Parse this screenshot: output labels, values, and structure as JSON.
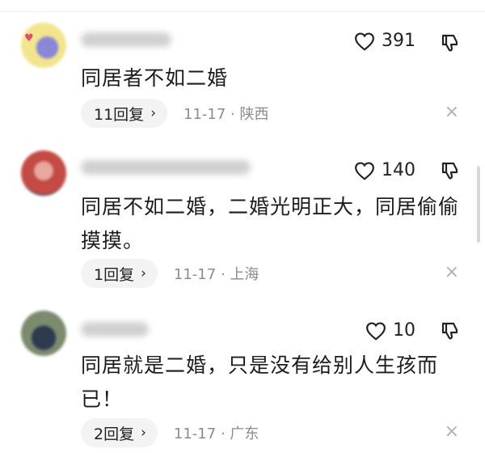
{
  "comments": [
    {
      "likes": "391",
      "text": "同居者不如二婚",
      "reply_label": "11回复",
      "date": "11-17",
      "location": "陕西"
    },
    {
      "likes": "140",
      "text": "同居不如二婚，二婚光明正大，同居偷偷摸摸。",
      "reply_label": "1回复",
      "date": "11-17",
      "location": "上海"
    },
    {
      "likes": "10",
      "text": "同居就是二婚，只是没有给别人生孩而已！",
      "reply_label": "2回复",
      "date": "11-17",
      "location": "广东"
    }
  ],
  "icons": {
    "like": "heart-outline-icon",
    "dislike": "thumbs-down-icon",
    "reply_arrow": "chevron-right-icon",
    "close": "close-icon"
  },
  "symbols": {
    "chevron": "›",
    "close": "×",
    "dot": "·"
  },
  "colors": {
    "text": "#1c1c1c",
    "muted": "#8c8c8c",
    "pill": "#f3f3f3"
  }
}
